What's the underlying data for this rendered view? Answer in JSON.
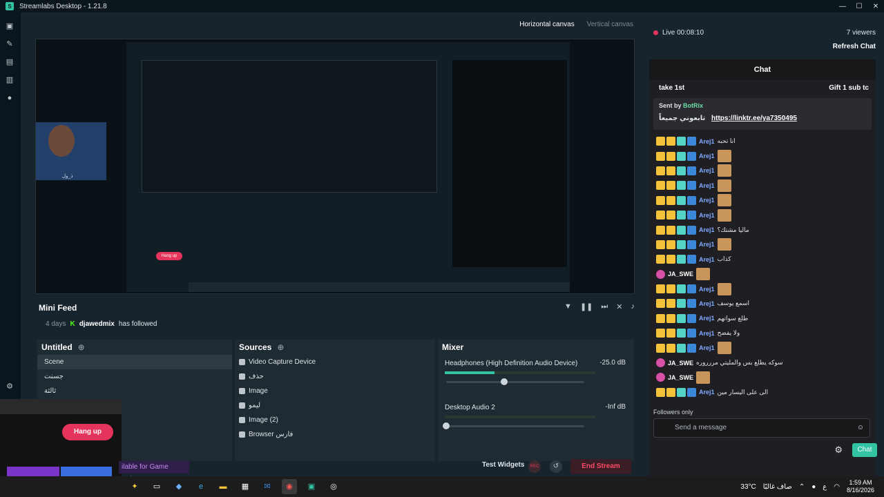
{
  "app": {
    "title": "Streamlabs Desktop - 1.21.8"
  },
  "window_controls": [
    "—",
    "☐",
    "✕"
  ],
  "canvas": {
    "horizontal": "Horizontal canvas",
    "vertical": "Vertical canvas"
  },
  "preview": {
    "cam_label": "ذ_ول",
    "nested_hang": "Hang up"
  },
  "minifeed": {
    "title": "Mini Feed",
    "time": "4 days",
    "user": "djawedmix",
    "action": "has followed"
  },
  "scenes": {
    "title": "Untitled",
    "items": [
      "Scene",
      "جسنت",
      "ثالثة"
    ]
  },
  "sources": {
    "title": "Sources",
    "items": [
      "Video Capture Device",
      "حذف",
      "Image",
      "ليمو",
      "Image (2)",
      "Browser فارس"
    ]
  },
  "mixer": {
    "title": "Mixer",
    "channels": [
      {
        "name": "Headphones (High Definition Audio Device)",
        "db": "-25.0 dB",
        "level": 0.33,
        "volume": 0.42
      },
      {
        "name": "Desktop Audio 2",
        "db": "-Inf dB",
        "level": 0,
        "volume": 0.0
      }
    ]
  },
  "bottom": {
    "test_widgets": "Test Widgets",
    "rec": "REC",
    "end_stream": "End Stream",
    "game_pulse": "ilable for Game Pulse!"
  },
  "call": {
    "hang_up": "Hang up"
  },
  "stream": {
    "status": "Live 00:08:10",
    "viewers": "7 viewers",
    "refresh": "Refresh Chat"
  },
  "chat": {
    "title": "Chat",
    "pinned_left": "take 1st",
    "pinned_right": "Gift 1 sub tc",
    "bot_sent_by": "Sent by",
    "bot_name": "BotRix",
    "bot_text": "تابعوني جميعاً",
    "bot_link": "https://linktr.ee/ya7350495",
    "messages": [
      {
        "user": "Arej1",
        "text": "انا تحبه"
      },
      {
        "user": "Arej1",
        "text": ""
      },
      {
        "user": "Arej1",
        "text": ""
      },
      {
        "user": "Arej1",
        "text": ""
      },
      {
        "user": "Arej1",
        "text": ""
      },
      {
        "user": "Arej1",
        "text": ""
      },
      {
        "user": "Arej1",
        "text": "ماليا مشتك؟"
      },
      {
        "user": "Arej1",
        "text": ""
      },
      {
        "user": "Arej1",
        "text": "كذاب"
      },
      {
        "user": "JA_SWE",
        "text": ""
      },
      {
        "user": "Arej1",
        "text": ""
      },
      {
        "user": "Arej1",
        "text": "اسمع يوسف"
      },
      {
        "user": "Arej1",
        "text": "طلع سواتهم"
      },
      {
        "user": "Arej1",
        "text": "ولا يفضح"
      },
      {
        "user": "Arej1",
        "text": ""
      },
      {
        "user": "JA_SWE",
        "text": "سوكه يطلع بس والمليتي مررروره"
      },
      {
        "user": "JA_SWE",
        "text": ""
      },
      {
        "user": "Arej1",
        "text": "الى على اليسار مين"
      }
    ],
    "followers_only": "Followers only",
    "send_placeholder": "Send a message",
    "send_button": "Chat"
  },
  "taskbar": {
    "weather": "33°C",
    "weather_text": "صاف غالبًا",
    "lang": "ع",
    "time": "1:59 AM",
    "date": "8/16/2026"
  },
  "colors": {
    "accent": "#31c3a2",
    "danger": "#e4345b",
    "panel": "#1e2b33"
  }
}
